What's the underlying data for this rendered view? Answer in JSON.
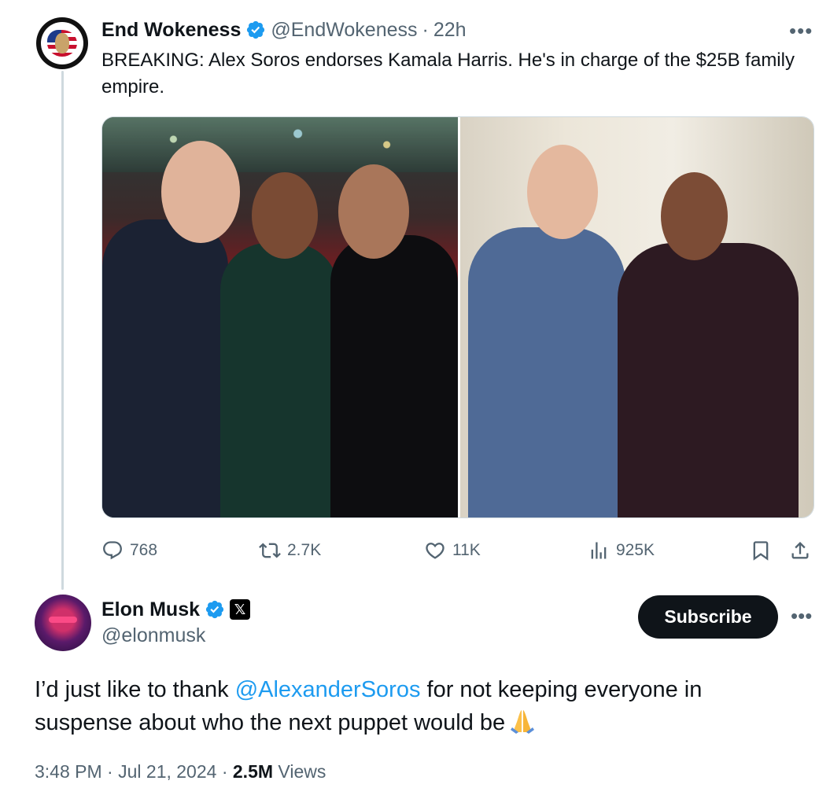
{
  "parent_tweet": {
    "author_name": "End Wokeness",
    "author_handle": "@EndWokeness",
    "separator": "·",
    "time": "22h",
    "more": "•••",
    "text": "BREAKING: Alex Soros endorses Kamala Harris. He's in charge of the $25B family empire.",
    "stats": {
      "replies": "768",
      "reposts": "2.7K",
      "likes": "11K",
      "views": "925K"
    }
  },
  "main_tweet": {
    "author_name": "Elon Musk",
    "author_handle": "@elonmusk",
    "subscribe_label": "Subscribe",
    "more": "•••",
    "text_before": "I’d just like to thank ",
    "mention": "@AlexanderSoros",
    "text_after": " for not keeping everyone in suspense about who the next puppet would be",
    "time": "3:48 PM",
    "date": "Jul 21, 2024",
    "views_count": "2.5M",
    "views_label": "Views",
    "dot": "·"
  },
  "colors": {
    "accent": "#1d9bf0",
    "text_primary": "#0f1419",
    "text_secondary": "#536471",
    "thread_line": "#cfd9de"
  },
  "icons": [
    "verified-badge-icon",
    "x-affiliate-icon",
    "reply-icon",
    "repost-icon",
    "like-icon",
    "views-icon",
    "bookmark-icon",
    "share-icon",
    "folded-hands-emoji"
  ]
}
